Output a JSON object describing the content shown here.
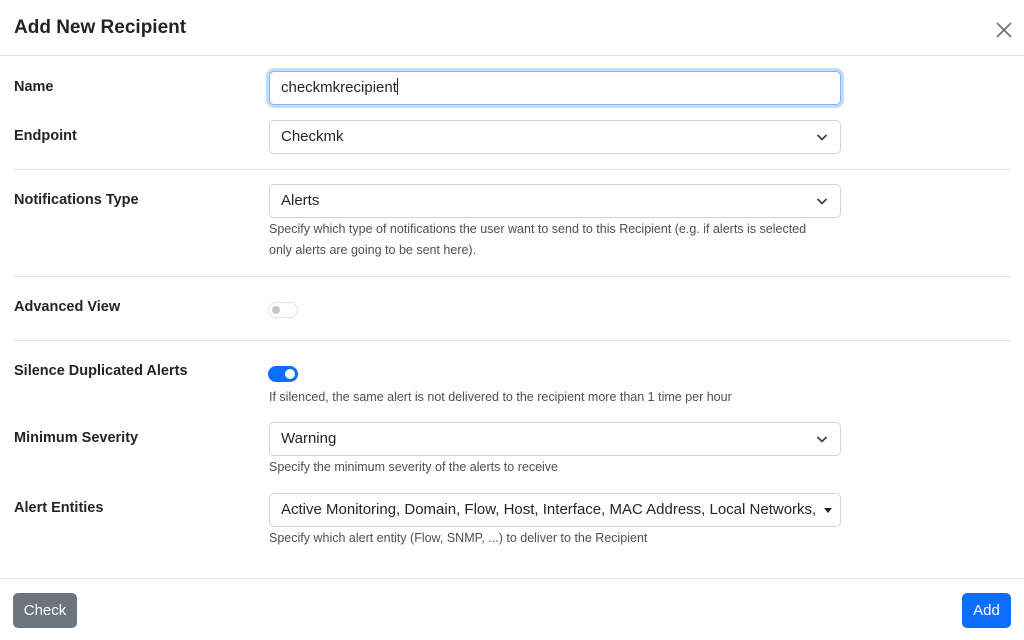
{
  "dialog": {
    "title": "Add New Recipient"
  },
  "fields": {
    "name": {
      "label": "Name",
      "value": "checkmkrecipient"
    },
    "endpoint": {
      "label": "Endpoint",
      "value": "Checkmk"
    },
    "notifications_type": {
      "label": "Notifications Type",
      "value": "Alerts",
      "help_line1": "Specify which type of notifications the user want to send to this Recipient (e.g. if alerts is selected",
      "help_line2": "only alerts are going to be sent here)."
    },
    "advanced_view": {
      "label": "Advanced View",
      "enabled": false
    },
    "silence_duplicated": {
      "label": "Silence Duplicated Alerts",
      "enabled": true,
      "help": "If silenced, the same alert is not delivered to the recipient more than 1 time per hour"
    },
    "minimum_severity": {
      "label": "Minimum Severity",
      "value": "Warning",
      "help": "Specify the minimum severity of the alerts to receive"
    },
    "alert_entities": {
      "label": "Alert Entities",
      "value": "Active Monitoring, Domain, Flow, Host, Interface, MAC Address, Local Networks, Ot",
      "help": "Specify which alert entity (Flow, SNMP, ...) to deliver to the Recipient"
    }
  },
  "footer": {
    "check_label": "Check",
    "add_label": "Add"
  },
  "colors": {
    "primary": "#0d6efd",
    "secondary": "#6c757d"
  }
}
